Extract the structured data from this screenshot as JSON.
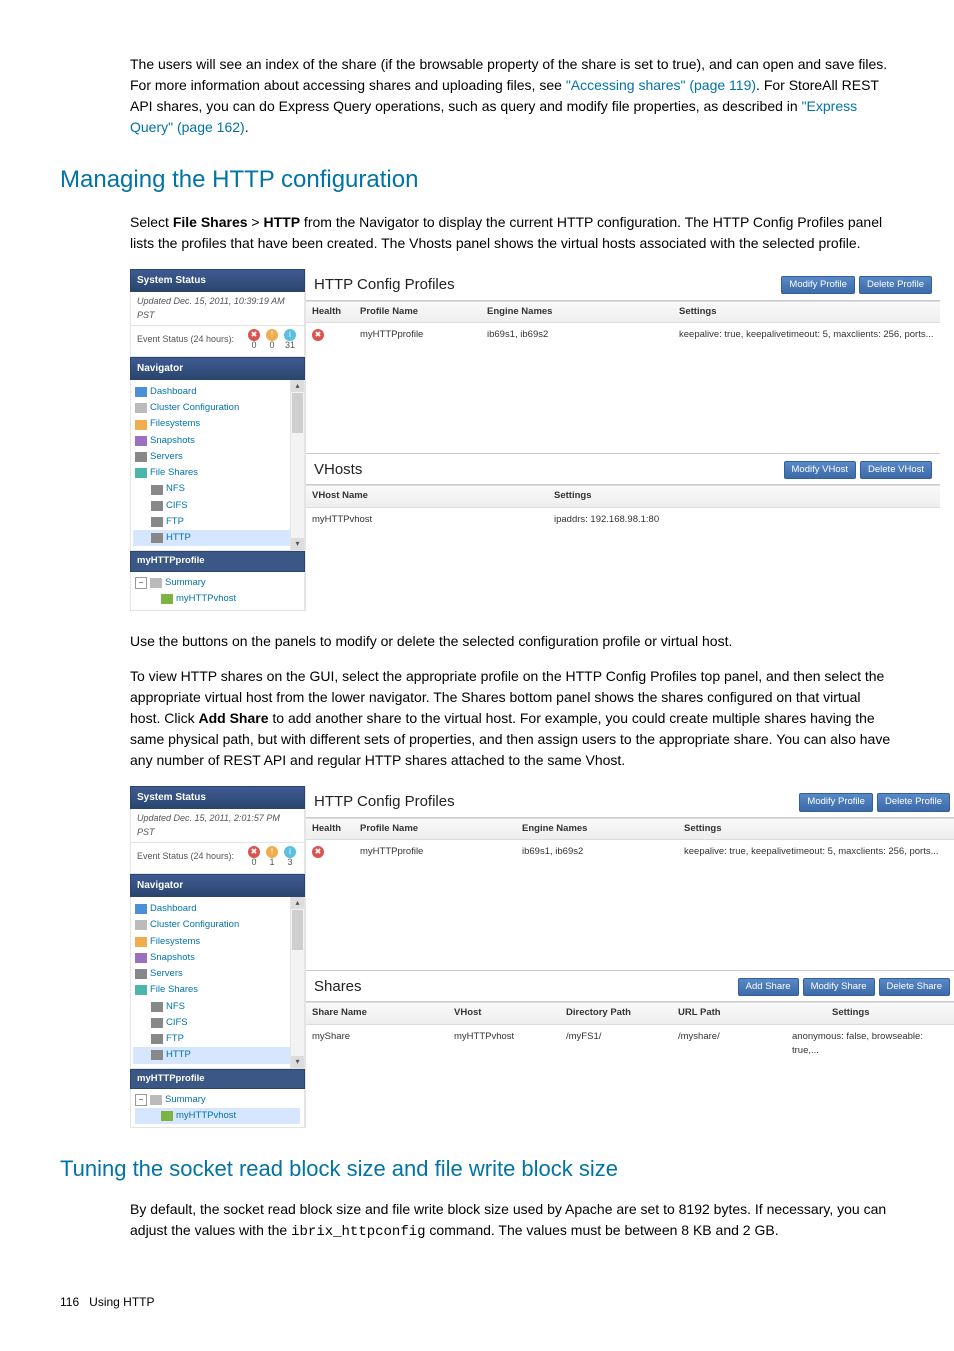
{
  "para1": {
    "t1": "The users will see an index of the share (if the browsable property of the share is set to true), and can open and save files. For more information about accessing shares and uploading files, see ",
    "link1": "\"Accessing shares\" (page 119)",
    "t2": ". For StoreAll REST API shares, you can do Express Query operations, such as query and modify file properties, as described in ",
    "link2": "\"Express Query\" (page 162)",
    "t3": "."
  },
  "h1": "Managing the HTTP configuration",
  "para2": {
    "t1": "Select ",
    "b1": "File Shares",
    "t2": " > ",
    "b2": "HTTP",
    "t3": " from the Navigator to display the current HTTP configuration. The HTTP Config Profiles panel lists the profiles that have been created. The Vhosts panel shows the virtual hosts associated with the selected profile."
  },
  "shot1": {
    "system_status": "System Status",
    "updated": "Updated Dec. 15, 2011, 10:39:19 AM PST",
    "event_status_label": "Event Status (24 hours):",
    "ev_red": "0",
    "ev_yellow": "0",
    "ev_blue": "31",
    "navigator": "Navigator",
    "tree": {
      "dashboard": "Dashboard",
      "cluster": "Cluster Configuration",
      "filesystems": "Filesystems",
      "snapshots": "Snapshots",
      "servers": "Servers",
      "fileshares": "File Shares",
      "nfs": "NFS",
      "cifs": "CIFS",
      "ftp": "FTP",
      "http": "HTTP"
    },
    "lower_title": "myHTTPprofile",
    "summary": "Summary",
    "vhost_item": "myHTTPvhost",
    "profiles_title": "HTTP Config Profiles",
    "modify_profile": "Modify Profile",
    "delete_profile": "Delete Profile",
    "ph": {
      "health": "Health",
      "name": "Profile Name",
      "engine": "Engine Names",
      "settings": "Settings"
    },
    "prow": {
      "name": "myHTTPprofile",
      "engine": "ib69s1, ib69s2",
      "settings": "keepalive: true, keepalivetimeout: 5, maxclients: 256, ports..."
    },
    "vhosts_title": "VHosts",
    "modify_vhost": "Modify VHost",
    "delete_vhost": "Delete VHost",
    "vh": {
      "name": "VHost Name",
      "settings": "Settings"
    },
    "vrow": {
      "name": "myHTTPvhost",
      "settings": "ipaddrs: 192.168.98.1:80"
    }
  },
  "para3": "Use the buttons on the panels to modify or delete the selected configuration profile or virtual host.",
  "para4": {
    "t1": "To view HTTP shares on the GUI, select the appropriate profile on the HTTP Config Profiles top panel, and then select the appropriate virtual host from the lower navigator. The Shares bottom panel shows the shares configured on that virtual host. Click ",
    "b1": "Add Share",
    "t2": " to add another share to the virtual host. For example, you could create multiple shares having the same physical path, but with different sets of properties, and then assign users to the appropriate share. You can also have any number of REST API and regular HTTP shares attached to the same Vhost."
  },
  "shot2": {
    "updated": "Updated Dec. 15, 2011, 2:01:57 PM PST",
    "ev_red": "0",
    "ev_yellow": "1",
    "ev_blue": "3",
    "lower_title": "myHTTPprofile",
    "summary": "Summary",
    "vhost_item": "myHTTPvhost",
    "profiles_title": "HTTP Config Profiles",
    "modify_profile": "Modify Profile",
    "delete_profile": "Delete Profile",
    "ph": {
      "health": "Health",
      "name": "Profile Name",
      "engine": "Engine Names",
      "settings": "Settings"
    },
    "prow": {
      "name": "myHTTPprofile",
      "engine": "ib69s1, ib69s2",
      "settings": "keepalive: true, keepalivetimeout: 5, maxclients: 256, ports..."
    },
    "shares_title": "Shares",
    "add_share": "Add Share",
    "modify_share": "Modify Share",
    "delete_share": "Delete Share",
    "sh": {
      "name": "Share Name",
      "vhost": "VHost",
      "dir": "Directory Path",
      "url": "URL Path",
      "settings": "Settings"
    },
    "srow": {
      "name": "myShare",
      "vhost": "myHTTPvhost",
      "dir": "/myFS1/",
      "url": "/myshare/",
      "settings": "anonymous: false, browseable: true,..."
    }
  },
  "h2": "Tuning the socket read block size and file write block size",
  "para5": {
    "t1": "By default, the socket read block size and file write block size used by Apache are set to 8192 bytes. If necessary, you can adjust the values with the ",
    "code": "ibrix_httpconfig",
    "t2": " command. The values must be between 8 KB and 2 GB."
  },
  "footer": {
    "page": "116",
    "label": "Using HTTP"
  }
}
